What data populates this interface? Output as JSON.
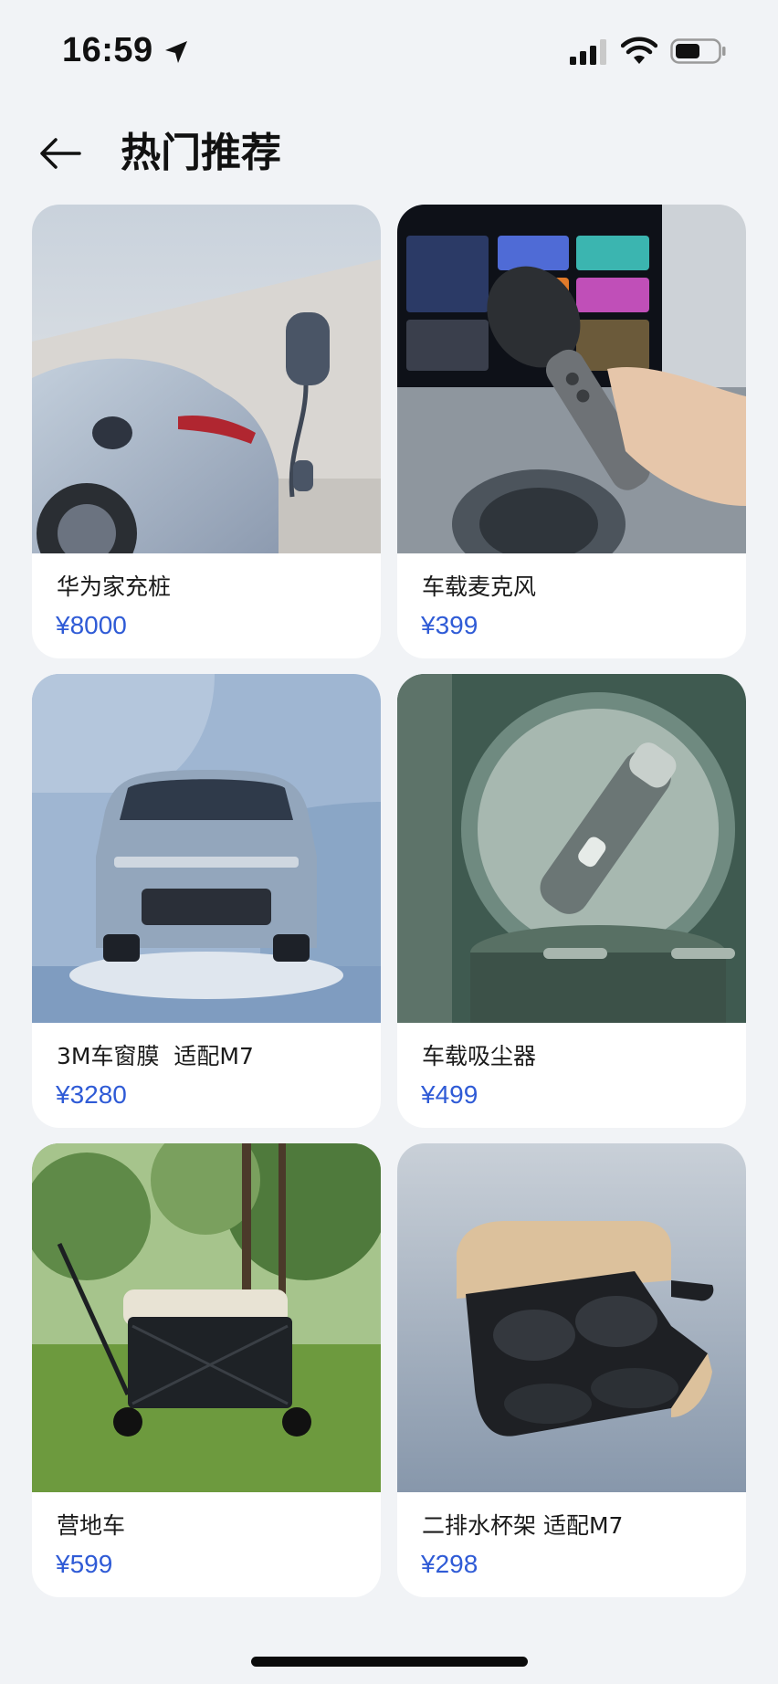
{
  "status_bar": {
    "time": "16:59",
    "icons": [
      "location-arrow-icon",
      "cellular-signal-icon",
      "wifi-icon",
      "battery-icon"
    ]
  },
  "header": {
    "back_icon": "arrow-left-icon",
    "title": "热门推荐"
  },
  "colors": {
    "background": "#f1f3f6",
    "card": "#ffffff",
    "price": "#2f5bd6",
    "text": "#1a1a1a"
  },
  "products": [
    {
      "name": "华为家充桩",
      "price": "¥8000"
    },
    {
      "name": "车载麦克风",
      "price": "¥399"
    },
    {
      "name": "3M车窗膜  适配M7",
      "price": "¥3280"
    },
    {
      "name": "车载吸尘器",
      "price": "¥499"
    },
    {
      "name": "营地车",
      "price": "¥599"
    },
    {
      "name": "二排水杯架 适配M7",
      "price": "¥298"
    }
  ]
}
